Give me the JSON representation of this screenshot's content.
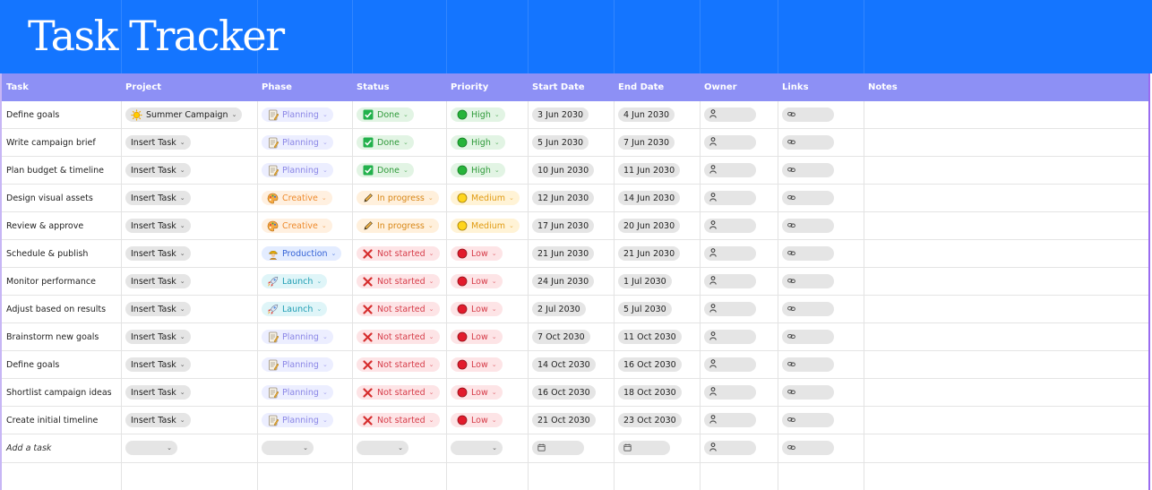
{
  "title": "Task Tracker",
  "colors": {
    "banner": "#1475ff",
    "header": "#8d90f5"
  },
  "columns": [
    "Task",
    "Project",
    "Phase",
    "Status",
    "Priority",
    "Start Date",
    "End Date",
    "Owner",
    "Links",
    "Notes"
  ],
  "rows": [
    {
      "task": "Define goals",
      "project": "Summer Campaign",
      "project_icon": "sun-icon",
      "phase": "Planning",
      "phase_icon": "memo-icon",
      "phase_style": "planning",
      "status": "Done",
      "status_icon": "check-box-icon",
      "status_style": "done",
      "priority": "High",
      "priority_style": "high",
      "start": "3 Jun 2030",
      "end": "4 Jun 2030"
    },
    {
      "task": "Write campaign brief",
      "project": "Insert Task",
      "phase": "Planning",
      "phase_icon": "memo-icon",
      "phase_style": "planning",
      "status": "Done",
      "status_icon": "check-box-icon",
      "status_style": "done",
      "priority": "High",
      "priority_style": "high",
      "start": "5 Jun 2030",
      "end": "7 Jun 2030"
    },
    {
      "task": "Plan budget & timeline",
      "project": "Insert Task",
      "phase": "Planning",
      "phase_icon": "memo-icon",
      "phase_style": "planning",
      "status": "Done",
      "status_icon": "check-box-icon",
      "status_style": "done",
      "priority": "High",
      "priority_style": "high",
      "start": "10 Jun 2030",
      "end": "11 Jun 2030"
    },
    {
      "task": "Design visual assets",
      "project": "Insert Task",
      "phase": "Creative",
      "phase_icon": "palette-icon",
      "phase_style": "creative",
      "status": "In progress",
      "status_icon": "pencil-icon",
      "status_style": "inprog",
      "priority": "Medium",
      "priority_style": "medium",
      "start": "12 Jun 2030",
      "end": "14 Jun 2030"
    },
    {
      "task": "Review & approve",
      "project": "Insert Task",
      "phase": "Creative",
      "phase_icon": "palette-icon",
      "phase_style": "creative",
      "status": "In progress",
      "status_icon": "pencil-icon",
      "status_style": "inprog",
      "priority": "Medium",
      "priority_style": "medium",
      "start": "17 Jun 2030",
      "end": "20 Jun 2030"
    },
    {
      "task": "Schedule & publish",
      "project": "Insert Task",
      "phase": "Production",
      "phase_icon": "worker-icon",
      "phase_style": "production",
      "status": "Not started",
      "status_icon": "cross-icon",
      "status_style": "notstart",
      "priority": "Low",
      "priority_style": "low",
      "start": "21 Jun 2030",
      "end": "21 Jun 2030"
    },
    {
      "task": "Monitor performance",
      "project": "Insert Task",
      "phase": "Launch",
      "phase_icon": "rocket-icon",
      "phase_style": "launch",
      "status": "Not started",
      "status_icon": "cross-icon",
      "status_style": "notstart",
      "priority": "Low",
      "priority_style": "low",
      "start": "24 Jun 2030",
      "end": "1 Jul 2030"
    },
    {
      "task": "Adjust based on results",
      "project": "Insert Task",
      "phase": "Launch",
      "phase_icon": "rocket-icon",
      "phase_style": "launch",
      "status": "Not started",
      "status_icon": "cross-icon",
      "status_style": "notstart",
      "priority": "Low",
      "priority_style": "low",
      "start": "2 Jul 2030",
      "end": "5 Jul 2030"
    },
    {
      "task": "Brainstorm new goals",
      "project": "Insert Task",
      "phase": "Planning",
      "phase_icon": "memo-icon",
      "phase_style": "planning",
      "status": "Not started",
      "status_icon": "cross-icon",
      "status_style": "notstart",
      "priority": "Low",
      "priority_style": "low",
      "start": "7 Oct 2030",
      "end": "11 Oct 2030"
    },
    {
      "task": "Define goals",
      "project": "Insert Task",
      "phase": "Planning",
      "phase_icon": "memo-icon",
      "phase_style": "planning",
      "status": "Not started",
      "status_icon": "cross-icon",
      "status_style": "notstart",
      "priority": "Low",
      "priority_style": "low",
      "start": "14 Oct 2030",
      "end": "16 Oct 2030"
    },
    {
      "task": "Shortlist campaign ideas",
      "project": "Insert Task",
      "phase": "Planning",
      "phase_icon": "memo-icon",
      "phase_style": "planning",
      "status": "Not started",
      "status_icon": "cross-icon",
      "status_style": "notstart",
      "priority": "Low",
      "priority_style": "low",
      "start": "16 Oct 2030",
      "end": "18 Oct 2030"
    },
    {
      "task": "Create initial timeline",
      "project": "Insert Task",
      "phase": "Planning",
      "phase_icon": "memo-icon",
      "phase_style": "planning",
      "status": "Not started",
      "status_icon": "cross-icon",
      "status_style": "notstart",
      "priority": "Low",
      "priority_style": "low",
      "start": "21 Oct 2030",
      "end": "23 Oct 2030"
    }
  ],
  "add_row_label": "Add a task"
}
